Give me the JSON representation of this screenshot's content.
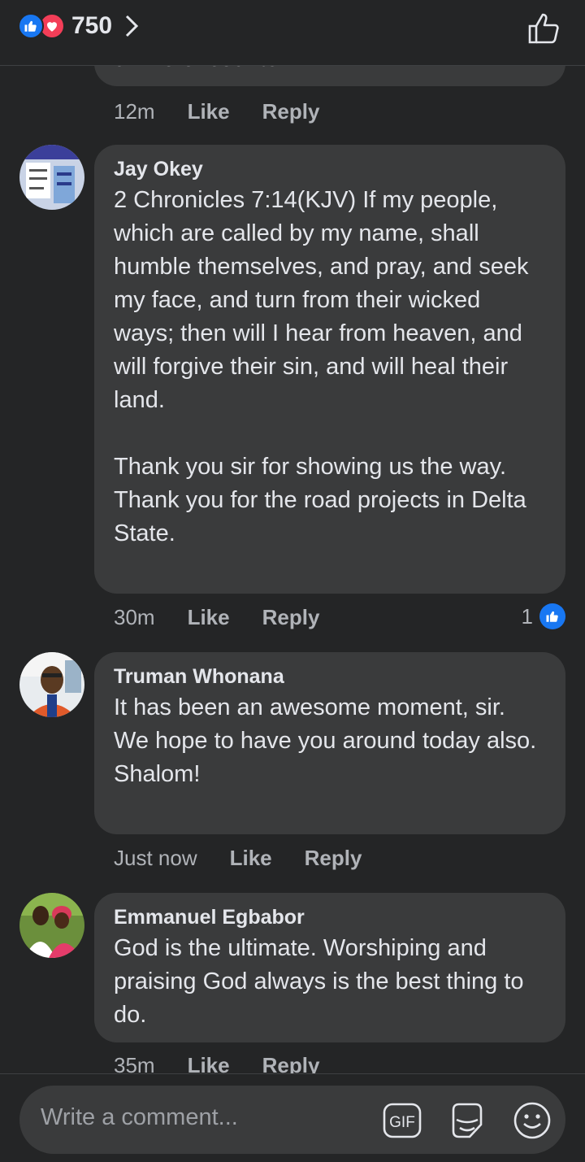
{
  "header": {
    "reaction_count": "750",
    "icons": [
      "like-reaction-icon",
      "love-reaction-icon",
      "chevron-right-icon",
      "thumbs-up-outline-icon"
    ]
  },
  "partial_comment": {
    "text": "divine encounter.",
    "meta": {
      "time": "12m",
      "like": "Like",
      "reply": "Reply"
    }
  },
  "comments": [
    {
      "author": "Jay Okey",
      "text": "2 Chronicles 7:14(KJV) If my people, which are called by my name, shall humble themselves, and pray, and seek my face, and turn from their wicked ways; then will I hear from heaven, and will forgive their sin, and will heal their land.\n\nThank you sir for showing us the way.\nThank you for the road projects in Delta  State.",
      "time": "30m",
      "like": "Like",
      "reply": "Reply",
      "reaction_count": "1"
    },
    {
      "author": "Truman Whonana",
      "text": "It has been an awesome moment, sir. We hope to have you around today also.\nShalom!",
      "time": "Just now",
      "like": "Like",
      "reply": "Reply"
    },
    {
      "author": "Emmanuel Egbabor",
      "text": "God is the ultimate. Worshiping and praising God always is the best thing to do.",
      "time": "35m",
      "like": "Like",
      "reply": "Reply"
    }
  ],
  "composer": {
    "placeholder": "Write a comment...",
    "gif_label": "GIF",
    "icons": [
      "gif-icon",
      "sticker-icon",
      "emoji-icon"
    ]
  },
  "colors": {
    "background": "#242526",
    "bubble": "#3a3b3c",
    "accent": "#1877f2",
    "love": "#f33e58"
  }
}
